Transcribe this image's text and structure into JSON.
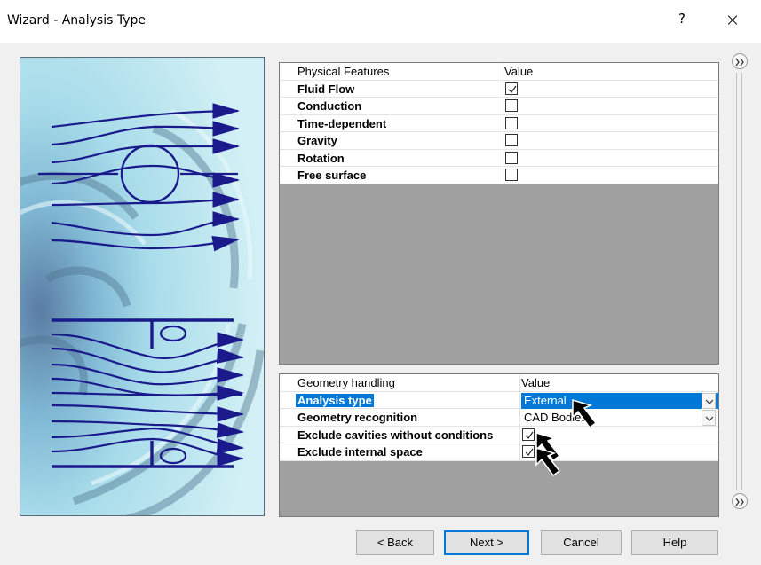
{
  "window": {
    "title": "Wizard - Analysis Type",
    "help_label": "?",
    "close_label": "×"
  },
  "physical_features": {
    "header": {
      "name": "Physical Features",
      "value": "Value"
    },
    "rows": [
      {
        "name": "Fluid Flow",
        "checked": true
      },
      {
        "name": "Conduction",
        "checked": false
      },
      {
        "name": "Time-dependent",
        "checked": false
      },
      {
        "name": "Gravity",
        "checked": false
      },
      {
        "name": "Rotation",
        "checked": false
      },
      {
        "name": "Free surface",
        "checked": false
      }
    ]
  },
  "geometry_handling": {
    "header": {
      "name": "Geometry handling",
      "value": "Value"
    },
    "analysis_type": {
      "name": "Analysis type",
      "value": "External"
    },
    "geometry_recognition": {
      "name": "Geometry recognition",
      "value": "CAD Bodies"
    },
    "exclude_cavities": {
      "name": "Exclude cavities without conditions",
      "checked": true
    },
    "exclude_internal": {
      "name": "Exclude internal space",
      "checked": true
    }
  },
  "buttons": {
    "back": "< Back",
    "next": "Next >",
    "cancel": "Cancel",
    "help": "Help"
  },
  "colors": {
    "selection": "#0078d7",
    "grid_empty": "#a0a0a0",
    "flow_lines": "#1a1a8c"
  }
}
